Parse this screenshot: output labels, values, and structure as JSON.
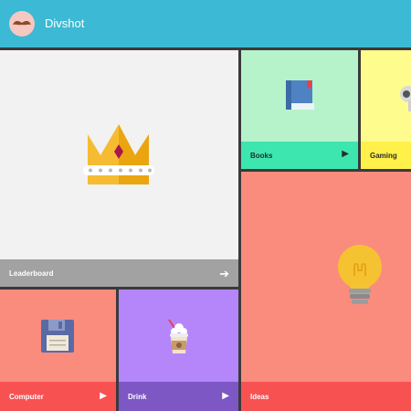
{
  "header": {
    "title": "Divshot",
    "logo_icon": "mustache-avatar-icon"
  },
  "tiles": [
    {
      "id": "leaderboard",
      "label": "Leaderboard",
      "icon": "crown-icon",
      "action_icon": "arrow-right-icon",
      "bg": "#f2f2f2",
      "bar": "#a2a2a2"
    },
    {
      "id": "books",
      "label": "Books",
      "icon": "book-icon",
      "action_icon": "play-icon",
      "bg": "#b6f3cb",
      "bar": "#3de6af"
    },
    {
      "id": "gaming",
      "label": "Gaming",
      "icon": "game-controller-icon",
      "bg": "#fefc8d",
      "bar": "#fff04a"
    },
    {
      "id": "ideas",
      "label": "Ideas",
      "icon": "lightbulb-icon",
      "bg": "#fa8c7e",
      "bar": "#f85152"
    },
    {
      "id": "computer",
      "label": "Computer",
      "icon": "floppy-disk-icon",
      "action_icon": "play-icon",
      "bg": "#fa8c7e",
      "bar": "#f85152"
    },
    {
      "id": "drink",
      "label": "Drink",
      "icon": "milkshake-icon",
      "action_icon": "play-icon",
      "bg": "#b586f9",
      "bar": "#7d57c4"
    }
  ],
  "colors": {
    "header": "#3cb9d4",
    "grid_gap": "#3a3a3a"
  }
}
